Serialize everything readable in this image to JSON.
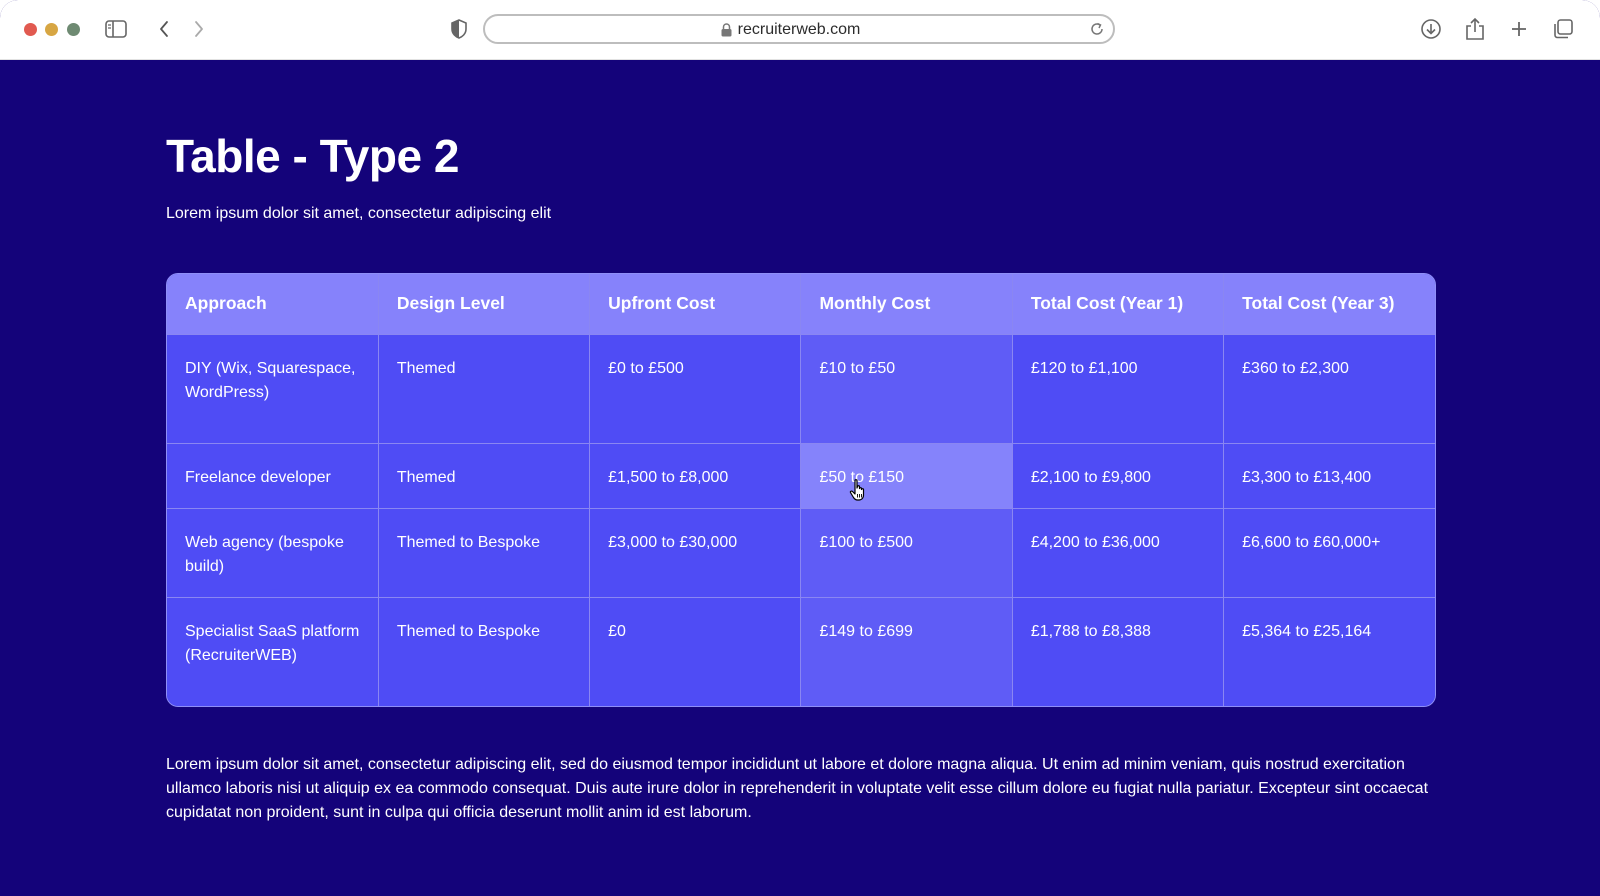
{
  "browser": {
    "url": "recruiterweb.com",
    "icons": [
      "sidebar-icon",
      "back-icon",
      "forward-icon",
      "privacy-shield-icon",
      "lock-icon",
      "reload-icon",
      "download-icon",
      "share-icon",
      "new-tab-icon",
      "tabs-overview-icon"
    ]
  },
  "page": {
    "title": "Table - Type 2",
    "subtitle": "Lorem ipsum dolor sit amet, consectetur adipiscing elit",
    "body": "Lorem ipsum dolor sit amet, consectetur adipiscing elit, sed do eiusmod tempor incididunt ut labore et dolore magna aliqua. Ut enim ad minim veniam, quis nostrud exercitation ullamco laboris nisi ut aliquip ex ea commodo consequat. Duis aute irure dolor in reprehenderit in voluptate velit esse cillum dolore eu fugiat nulla pariatur. Excepteur sint occaecat cupidatat non proident, sunt in culpa qui officia deserunt mollit anim id est laborum."
  },
  "table": {
    "headers": [
      "Approach",
      "Design Level",
      "Upfront Cost",
      "Monthly Cost",
      "Total Cost (Year 1)",
      "Total Cost (Year 3)"
    ],
    "rows": [
      [
        "DIY (Wix, Squarespace, WordPress)",
        "Themed",
        "£0 to £500",
        "£10 to £50",
        "£120 to £1,100",
        "£360 to £2,300"
      ],
      [
        "Freelance developer",
        "Themed",
        "£1,500 to £8,000",
        "£50 to £150",
        "£2,100 to £9,800",
        "£3,300 to £13,400"
      ],
      [
        "Web agency (bespoke build)",
        "Themed to Bespoke",
        "£3,000 to £30,000",
        "£100 to £500",
        "£4,200 to £36,000",
        "£6,600 to £60,000+"
      ],
      [
        "Specialist SaaS platform (RecruiterWEB)",
        "Themed to Bespoke",
        "£0",
        "£149 to £699",
        "£1,788 to £8,388",
        "£5,364 to £25,164"
      ]
    ]
  },
  "colors": {
    "page_background": "#14037a",
    "table_header": "#8682fb",
    "table_cell": "#4f4cf5",
    "monthly_column": "#5f5cf6",
    "hovered_cell": "#8583fb"
  }
}
